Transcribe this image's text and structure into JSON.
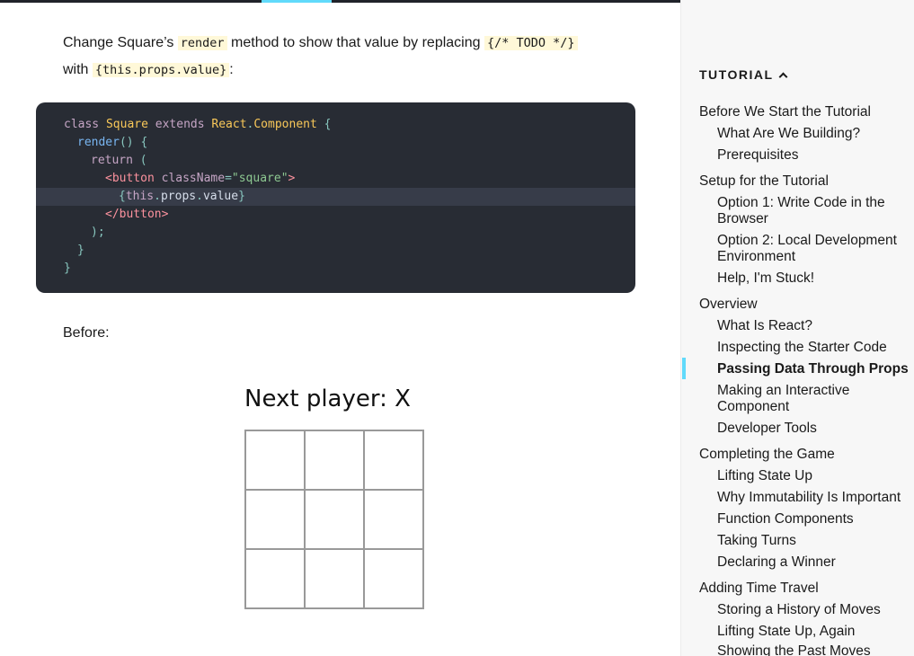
{
  "intro": {
    "text1": "Change Square’s ",
    "code1": "render",
    "text2": " method to show that value by replacing ",
    "code2": "{/* TODO */}",
    "text3": " with ",
    "code3": "{this.props.value}",
    "text4": ":"
  },
  "code": {
    "l1": {
      "a": "class",
      "b": " Square ",
      "c": "extends",
      "d": " React",
      "e": ".",
      "f": "Component",
      "g": " {"
    },
    "l2": {
      "a": "render",
      "b": "() {"
    },
    "l3": {
      "a": "return",
      "b": " ("
    },
    "l4": {
      "a": "<button",
      "b": " className",
      "c": "=",
      "d": "\"square\"",
      "e": ">"
    },
    "l5": {
      "a": "{",
      "b": "this",
      "c": ".",
      "d": "props",
      "e": ".",
      "f": "value",
      "g": "}"
    },
    "l6": {
      "a": "</button>"
    },
    "l7": {
      "a": ");"
    },
    "l8": {
      "a": "}"
    },
    "l9": {
      "a": "}"
    }
  },
  "before_label": "Before:",
  "game": {
    "status": "Next player: X",
    "squares": [
      "",
      "",
      "",
      "",
      "",
      "",
      "",
      "",
      ""
    ]
  },
  "sidebar": {
    "section_title": "TUTORIAL",
    "items": [
      {
        "label": "Before We Start the Tutorial",
        "level": 1
      },
      {
        "label": "What Are We Building?",
        "level": 2
      },
      {
        "label": "Prerequisites",
        "level": 2
      },
      {
        "label": "Setup for the Tutorial",
        "level": 1
      },
      {
        "label": "Option 1: Write Code in the Browser",
        "level": 2
      },
      {
        "label": "Option 2: Local Development Environment",
        "level": 2
      },
      {
        "label": "Help, I'm Stuck!",
        "level": 2
      },
      {
        "label": "Overview",
        "level": 1
      },
      {
        "label": "What Is React?",
        "level": 2
      },
      {
        "label": "Inspecting the Starter Code",
        "level": 2
      },
      {
        "label": "Passing Data Through Props",
        "level": 2,
        "current": true
      },
      {
        "label": "Making an Interactive Component",
        "level": 2
      },
      {
        "label": "Developer Tools",
        "level": 2
      },
      {
        "label": "Completing the Game",
        "level": 1
      },
      {
        "label": "Lifting State Up",
        "level": 2
      },
      {
        "label": "Why Immutability Is Important",
        "level": 2
      },
      {
        "label": "Function Components",
        "level": 2
      },
      {
        "label": "Taking Turns",
        "level": 2
      },
      {
        "label": "Declaring a Winner",
        "level": 2
      },
      {
        "label": "Adding Time Travel",
        "level": 1
      },
      {
        "label": "Storing a History of Moves",
        "level": 2
      },
      {
        "label": "Lifting State Up, Again",
        "level": 2
      },
      {
        "label": "Showing the Past Moves",
        "level": 2
      }
    ]
  },
  "colors": {
    "accent": "#61dafb",
    "topbar": "#20232a",
    "code_bg": "#282c34"
  }
}
